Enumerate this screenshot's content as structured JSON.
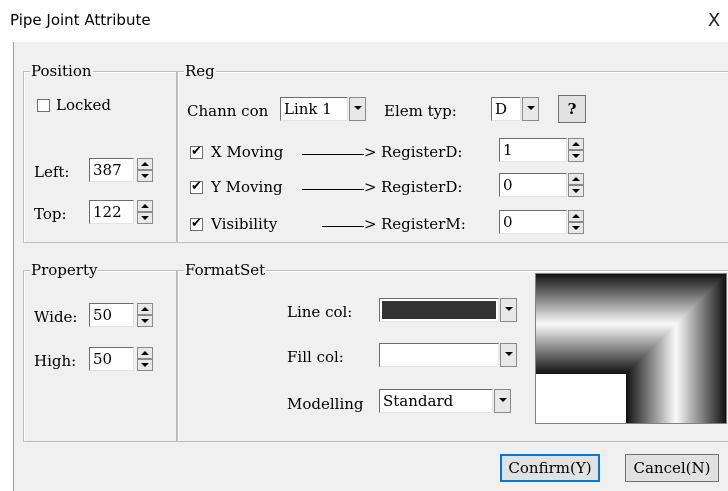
{
  "window": {
    "title": "Pipe Joint Attribute",
    "close_glyph": "X"
  },
  "position": {
    "group_label": "Position",
    "locked_label": "Locked",
    "locked_checked": false,
    "left_label": "Left:",
    "left_value": "387",
    "top_label": "Top:",
    "top_value": "122"
  },
  "reg": {
    "group_label": "Reg",
    "chann_label": "Chann con",
    "chann_value": "Link 1",
    "elem_label": "Elem typ:",
    "elem_value": "D",
    "help_label": "?",
    "rows": [
      {
        "label": "X Moving",
        "checked": true,
        "arrow": ">",
        "reg_label": "RegisterD:",
        "value": "1"
      },
      {
        "label": "Y Moving",
        "checked": true,
        "arrow": ">",
        "reg_label": "RegisterD:",
        "value": "0"
      },
      {
        "label": "Visibility",
        "checked": true,
        "arrow": ">",
        "reg_label": "RegisterM:",
        "value": "0"
      }
    ]
  },
  "property": {
    "group_label": "Property",
    "wide_label": "Wide:",
    "wide_value": "50",
    "high_label": "High:",
    "high_value": "50"
  },
  "formatset": {
    "group_label": "FormatSet",
    "line_col_label": "Line col:",
    "line_col_color": "#333333",
    "fill_col_label": "Fill col:",
    "fill_col_color": "#ffffff",
    "modelling_label": "Modelling",
    "modelling_value": "Standard"
  },
  "buttons": {
    "confirm_label": "Confirm(Y)",
    "cancel_label": "Cancel(N)"
  },
  "colors": {
    "dialog_bg": "#f0f0f0",
    "accent": "#0078d7"
  },
  "icons": {
    "spin_up": "spin-up-icon",
    "spin_down": "spin-down-icon",
    "dropdown": "chevron-down-icon",
    "check": "checkmark-icon",
    "close": "close-icon"
  }
}
